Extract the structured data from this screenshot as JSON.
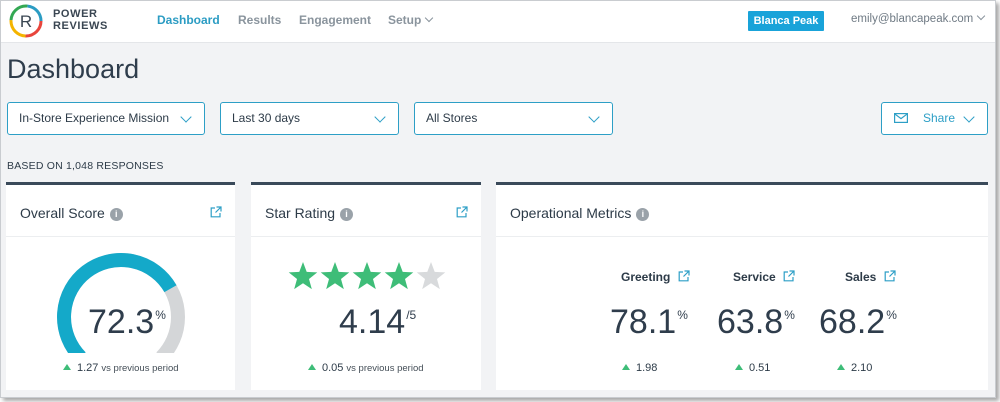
{
  "brand": {
    "line1": "POWER",
    "line2": "REVIEWS",
    "logo_letter": "R"
  },
  "nav": {
    "items": [
      {
        "label": "Dashboard",
        "active": true
      },
      {
        "label": "Results"
      },
      {
        "label": "Engagement"
      },
      {
        "label": "Setup"
      }
    ],
    "account_button": "Blanca Peak",
    "email": "emily@blancapeak.com"
  },
  "page_title": "Dashboard",
  "filters": {
    "mission": "In-Store Experience Mission",
    "date_range": "Last 30 days",
    "stores": "All Stores",
    "share_label": "Share"
  },
  "based_on": "BASED ON 1,048 RESPONSES",
  "overall_score": {
    "title": "Overall Score",
    "value": "72.3",
    "unit": "%",
    "gauge_fraction": 0.723,
    "delta": "1.27",
    "delta_text": "vs previous period"
  },
  "star_rating": {
    "title": "Star Rating",
    "value": "4.14",
    "out_of": "/5",
    "stars_filled": 4,
    "stars_total": 5,
    "delta": "0.05",
    "delta_text": "vs previous period"
  },
  "operational_metrics": {
    "title": "Operational Metrics",
    "metrics": [
      {
        "label": "Greeting",
        "value": "78.1",
        "unit": "%",
        "delta": "1.98"
      },
      {
        "label": "Service",
        "value": "63.8",
        "unit": "%",
        "delta": "0.51"
      },
      {
        "label": "Sales",
        "value": "68.2",
        "unit": "%",
        "delta": "2.10"
      }
    ]
  },
  "colors": {
    "accent": "#19a3d9",
    "gauge_fill": "#14a9c9",
    "gauge_track": "#d4d6d8",
    "star_filled": "#3ebd78",
    "star_empty": "#d8dadc",
    "delta_up": "#3ebd78"
  }
}
